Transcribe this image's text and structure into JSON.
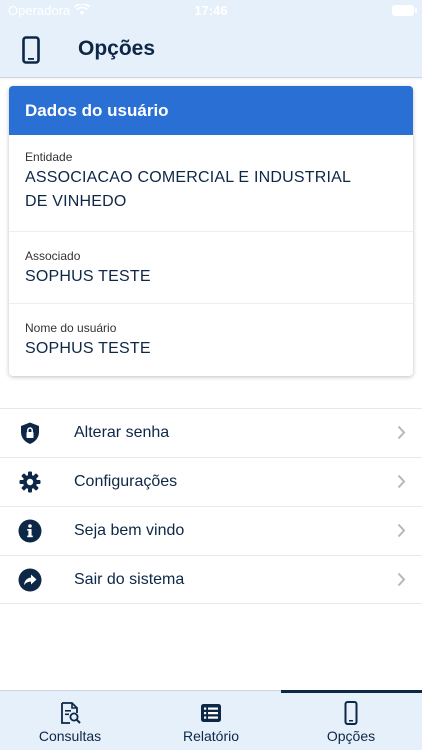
{
  "status_bar": {
    "carrier": "Operadora",
    "time": "17:46"
  },
  "header": {
    "title": "Opções",
    "icon": "phone-icon"
  },
  "user_card": {
    "title": "Dados do usuário",
    "fields": [
      {
        "label": "Entidade",
        "value": "ASSOCIACAO COMERCIAL E INDUSTRIAL DE VINHEDO"
      },
      {
        "label": "Associado",
        "value": "SOPHUS TESTE"
      },
      {
        "label": "Nome do usuário",
        "value": "SOPHUS TESTE"
      }
    ]
  },
  "menu": [
    {
      "label": "Alterar senha",
      "icon": "shield-lock-icon"
    },
    {
      "label": "Configurações",
      "icon": "gear-icon"
    },
    {
      "label": "Seja bem vindo",
      "icon": "info-icon"
    },
    {
      "label": "Sair do sistema",
      "icon": "share-arrow-icon"
    }
  ],
  "tabs": [
    {
      "label": "Consultas",
      "icon": "document-search-icon",
      "active": false
    },
    {
      "label": "Relatório",
      "icon": "list-icon",
      "active": false
    },
    {
      "label": "Opções",
      "icon": "phone-icon",
      "active": true
    }
  ],
  "colors": {
    "primary": "#2a6fd3",
    "navy": "#0d2747",
    "band": "#e6f0fa"
  }
}
